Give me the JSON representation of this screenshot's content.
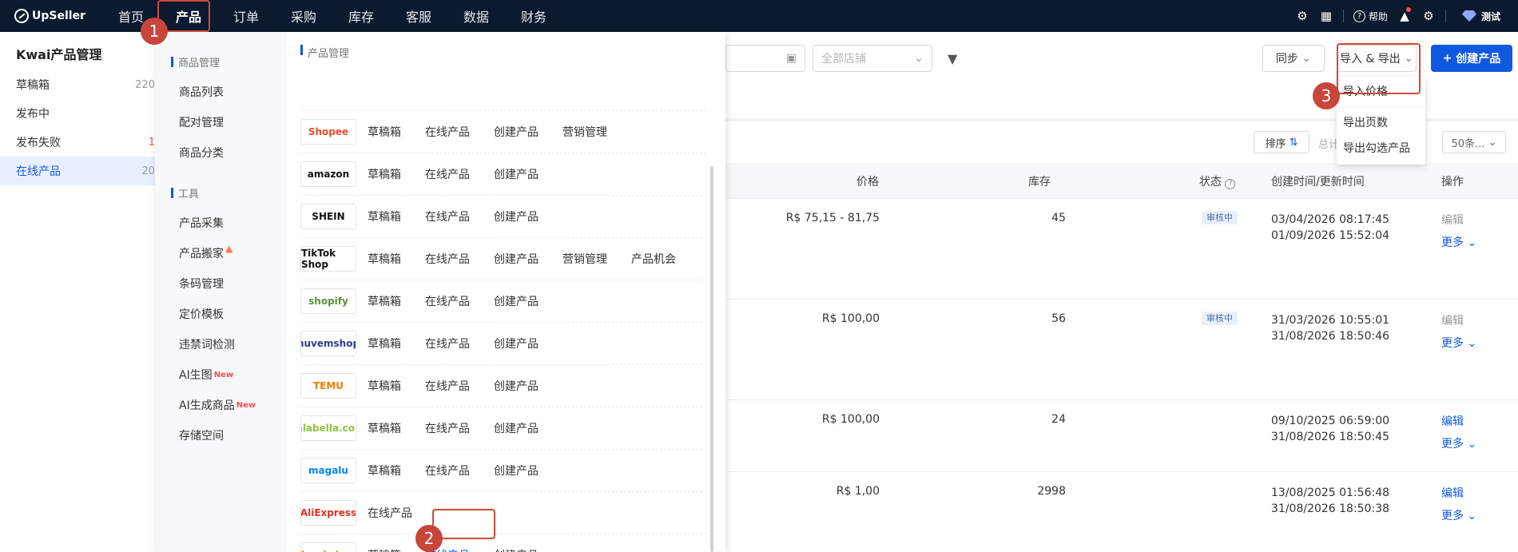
{
  "topbar": {
    "logo": "UpSeller",
    "nav": [
      "首页",
      "产品",
      "订单",
      "采购",
      "库存",
      "客服",
      "数据",
      "财务"
    ],
    "help": "帮助",
    "user": "测试"
  },
  "sidebar": {
    "title": "Kwai产品管理",
    "items": [
      {
        "label": "草稿箱",
        "count": "220"
      },
      {
        "label": "发布中",
        "count": ""
      },
      {
        "label": "发布失败",
        "count": "1"
      },
      {
        "label": "在线产品",
        "count": "20"
      }
    ]
  },
  "filters": {
    "store_placeholder": "全部店铺",
    "sync": "同步",
    "import_export": "导入 & 导出",
    "create": "创建产品"
  },
  "table": {
    "sort": "排序",
    "total_label": "总计",
    "page_size": "50条...",
    "headers": {
      "price": "价格",
      "stock": "库存",
      "status": "状态",
      "time": "创建时间/更新时间",
      "action": "操作"
    },
    "rows": [
      {
        "price": "R$ 75,15 - 81,75",
        "stock": "45",
        "status": "审核中",
        "created": "03/04/2026 08:17:45",
        "updated": "01/09/2026 15:52:04",
        "edit": "编辑",
        "more": "更多"
      },
      {
        "price": "R$ 100,00",
        "stock": "56",
        "status": "审核中",
        "created": "31/03/2026 10:55:01",
        "updated": "31/08/2026 18:50:46",
        "edit": "编辑",
        "more": "更多"
      },
      {
        "price": "R$ 100,00",
        "stock": "24",
        "status": "",
        "created": "09/10/2025 06:59:00",
        "updated": "31/08/2026 18:50:45",
        "edit": "编辑",
        "more": "更多"
      },
      {
        "price": "R$ 1,00",
        "stock": "2998",
        "status": "",
        "created": "13/08/2025 01:56:48",
        "updated": "31/08/2026 18:50:38",
        "edit": "编辑",
        "more": "更多"
      }
    ]
  },
  "mega": {
    "left_sections": [
      {
        "title": "商品管理",
        "links": [
          "商品列表",
          "配对管理",
          "商品分类"
        ]
      },
      {
        "title": "工具",
        "links": [
          "产品采集",
          "产品搬家",
          "条码管理",
          "定价模板",
          "违禁词检测",
          "AI生图",
          "AI生成商品",
          "存储空间"
        ]
      }
    ],
    "new_tag": "New",
    "right_title": "产品管理",
    "platforms": [
      {
        "logo": "Shopee",
        "color": "#ee4d2d",
        "links": [
          "草稿箱",
          "在线产品",
          "创建产品",
          "营销管理"
        ]
      },
      {
        "logo": "amazon",
        "color": "#111111",
        "links": [
          "草稿箱",
          "在线产品",
          "创建产品"
        ]
      },
      {
        "logo": "SHEIN",
        "color": "#111111",
        "links": [
          "草稿箱",
          "在线产品",
          "创建产品"
        ]
      },
      {
        "logo": "TikTok Shop",
        "color": "#111111",
        "links": [
          "草稿箱",
          "在线产品",
          "创建产品",
          "营销管理",
          "产品机会"
        ]
      },
      {
        "logo": "shopify",
        "color": "#5e8e3e",
        "links": [
          "草稿箱",
          "在线产品",
          "创建产品"
        ]
      },
      {
        "logo": "nuvemshop",
        "color": "#2c3e8c",
        "links": [
          "草稿箱",
          "在线产品",
          "创建产品"
        ]
      },
      {
        "logo": "TEMU",
        "color": "#f57c00",
        "links": [
          "草稿箱",
          "在线产品",
          "创建产品"
        ]
      },
      {
        "logo": "falabella.com",
        "color": "#8cc63f",
        "links": [
          "草稿箱",
          "在线产品",
          "创建产品"
        ]
      },
      {
        "logo": "magalu",
        "color": "#0086ff",
        "links": [
          "草稿箱",
          "在线产品",
          "创建产品"
        ]
      },
      {
        "logo": "AliExpress",
        "color": "#e43225",
        "links": [
          "在线产品"
        ]
      },
      {
        "logo": "kwai shop",
        "color": "#ff6a00",
        "links": [
          "草稿箱",
          "在线产品",
          "创建产品"
        ]
      }
    ]
  },
  "ie_menu": [
    "导入价格",
    "导出页数",
    "导出勾选产品"
  ],
  "markers": [
    "1",
    "2",
    "3"
  ]
}
